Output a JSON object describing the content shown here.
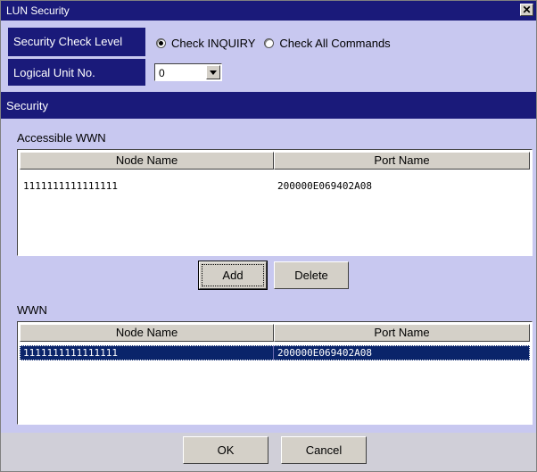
{
  "window": {
    "title": "LUN Security",
    "close_glyph": "✕",
    "close_icon": "close-icon"
  },
  "security_check": {
    "label": "Security Check Level",
    "options": [
      {
        "label": "Check INQUIRY",
        "checked": true
      },
      {
        "label": "Check All Commands",
        "checked": false
      }
    ]
  },
  "logical_unit": {
    "label": "Logical Unit No.",
    "value": "0"
  },
  "section": {
    "title": "Security"
  },
  "accessible": {
    "label": "Accessible WWN",
    "columns": [
      "Node Name",
      "Port Name"
    ],
    "rows": [
      {
        "node": "1111111111111111",
        "port": "200000E069402A08",
        "selected": false
      }
    ]
  },
  "buttons": {
    "add": "Add",
    "delete": "Delete",
    "ok": "OK",
    "cancel": "Cancel"
  },
  "wwn": {
    "label": "WWN",
    "columns": [
      "Node Name",
      "Port Name"
    ],
    "rows": [
      {
        "node": "1111111111111111",
        "port": "200000E069402A08",
        "selected": true
      }
    ]
  },
  "colors": {
    "title_bar": "#1a1a7a",
    "panel": "#c8c8f0",
    "selection": "#0a246a"
  }
}
